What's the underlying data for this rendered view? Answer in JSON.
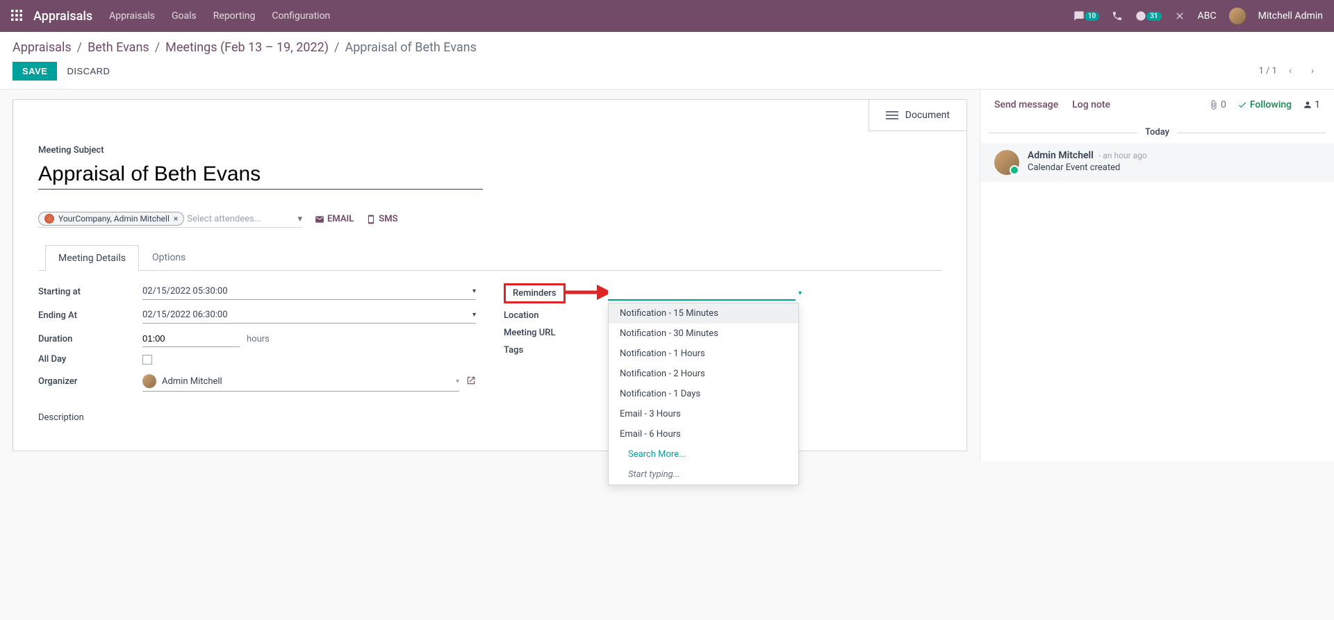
{
  "topbar": {
    "brand": "Appraisals",
    "nav": [
      "Appraisals",
      "Goals",
      "Reporting",
      "Configuration"
    ],
    "chat_badge": "10",
    "activity_badge": "31",
    "company": "ABC",
    "user": "Mitchell Admin"
  },
  "breadcrumb": {
    "items": [
      "Appraisals",
      "Beth Evans",
      "Meetings (Feb 13 – 19, 2022)"
    ],
    "current": "Appraisal of Beth Evans"
  },
  "actions": {
    "save": "SAVE",
    "discard": "DISCARD",
    "pager": "1 / 1"
  },
  "form": {
    "document_btn": "Document",
    "subject_label": "Meeting Subject",
    "subject": "Appraisal of Beth Evans",
    "attendee_chip": "YourCompany, Admin Mitchell",
    "attendee_placeholder": "Select attendees...",
    "email_btn": "EMAIL",
    "sms_btn": "SMS",
    "tabs": {
      "details": "Meeting Details",
      "options": "Options"
    },
    "left": {
      "starting_label": "Starting at",
      "starting": "02/15/2022 05:30:00",
      "ending_label": "Ending At",
      "ending": "02/15/2022 06:30:00",
      "duration_label": "Duration",
      "duration": "01:00",
      "hours": "hours",
      "allday_label": "All Day",
      "organizer_label": "Organizer",
      "organizer": "Admin Mitchell",
      "description_label": "Description"
    },
    "right": {
      "reminders_label": "Reminders",
      "location_label": "Location",
      "url_label": "Meeting URL",
      "tags_label": "Tags"
    },
    "dropdown": {
      "items": [
        "Notification - 15 Minutes",
        "Notification - 30 Minutes",
        "Notification - 1 Hours",
        "Notification - 2 Hours",
        "Notification - 1 Days",
        "Email - 3 Hours",
        "Email - 6 Hours"
      ],
      "search_more": "Search More...",
      "start_typing": "Start typing..."
    }
  },
  "chatter": {
    "send": "Send message",
    "log": "Log note",
    "attach_count": "0",
    "following": "Following",
    "followers": "1",
    "today": "Today",
    "msg_author": "Admin Mitchell",
    "msg_time": "- an hour ago",
    "msg_text": "Calendar Event created"
  }
}
